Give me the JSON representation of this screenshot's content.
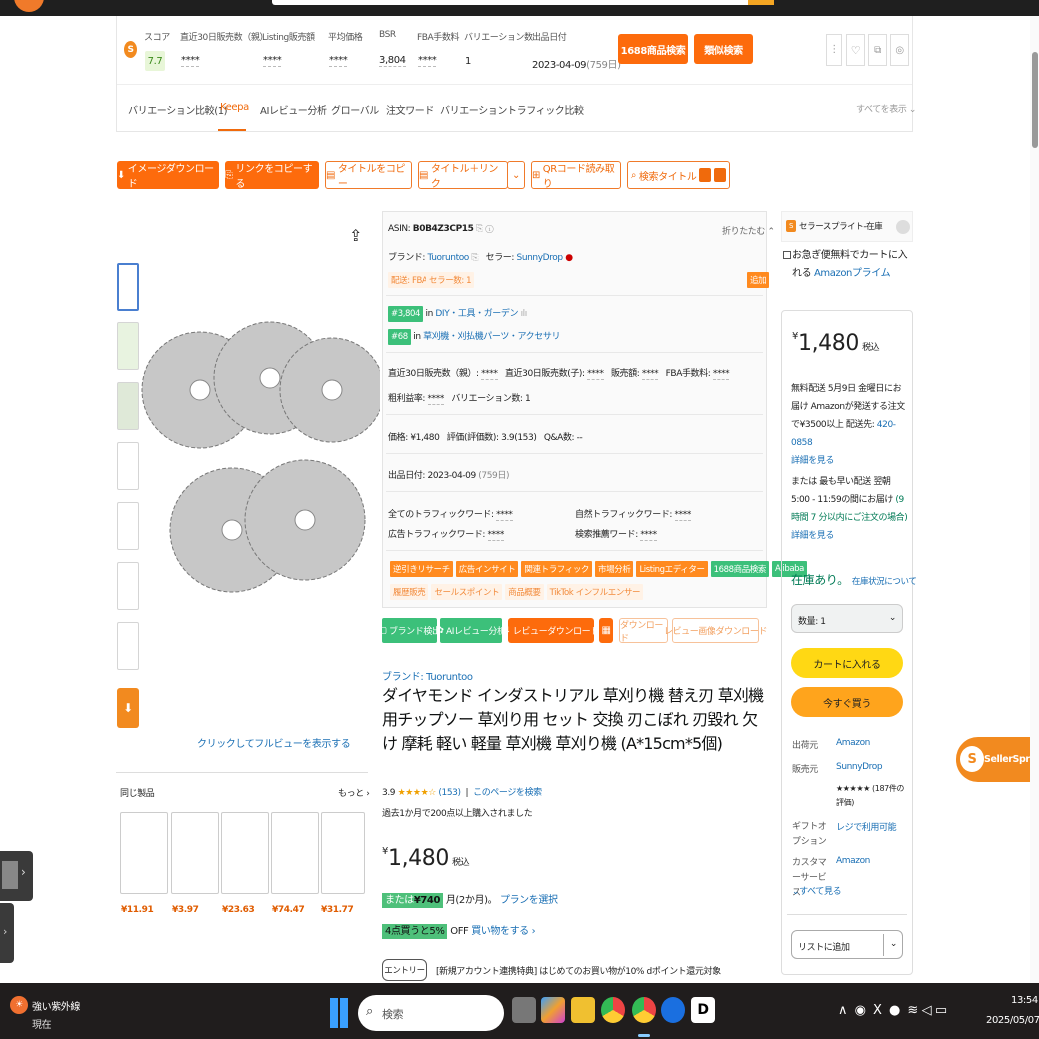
{
  "seller_bar": {
    "score_label": "スコア",
    "score": "7.7",
    "stats": [
      {
        "label": "直近30日販売数（親）",
        "value": "****"
      },
      {
        "label": "Listing販売額",
        "value": "****"
      },
      {
        "label": "平均価格",
        "value": "****"
      },
      {
        "label": "BSR",
        "value": "3,804"
      },
      {
        "label": "FBA手数料",
        "value": "****"
      },
      {
        "label": "バリエーション数",
        "value": "1"
      },
      {
        "label": "出品日付",
        "value": "2023-04-09"
      }
    ],
    "listing_days": "(759日)",
    "btn_1688": "1688商品検索",
    "btn_similar": "類似検索",
    "tabs": [
      "バリエーション比較(1)",
      "Keepa",
      "AIレビュー分析",
      "グローバル",
      "注文ワード",
      "バリエーショントラフィック比較"
    ],
    "show_all": "すべてを表示"
  },
  "toolbar": {
    "download_images": "イメージダウンロード",
    "copy_link": "リンクをコピーする",
    "copy_title": "タイトルをコピー",
    "title_link": "タイトル＋リンク",
    "qr": "QRコード読み取り",
    "search_title": "検索タイトル"
  },
  "gallery": {
    "full_view": "クリックしてフルビューを表示する",
    "similar": "同じ製品",
    "more": "もっと"
  },
  "similar_prices": [
    "¥11.91",
    "¥3.97",
    "¥23.63",
    "¥74.47",
    "¥31.77"
  ],
  "info": {
    "asin_label": "ASIN:",
    "asin": "B0B4Z3CP15",
    "collapse": "折りたたむ",
    "brand_label": "ブランド:",
    "brand": "Tuoruntoo",
    "seller_label": "セラー:",
    "seller": "SunnyDrop",
    "delivery": "配送: FBA",
    "seller_count": "セラー数: 1",
    "add": "追加",
    "rank1": "#3,804",
    "rank1_in": "in",
    "rank1_cat": "DIY・工具・ガーデン",
    "rank2": "#68",
    "rank2_cat": "草刈機・刈払機パーツ・アクセサリ",
    "row1": [
      {
        "label": "直近30日販売数（親）:",
        "value": "****"
      },
      {
        "label": "直近30日販売数(子):",
        "value": "****"
      },
      {
        "label": "販売額:",
        "value": "****"
      },
      {
        "label": "FBA手数料:",
        "value": "****"
      }
    ],
    "margin_label": "粗利益率:",
    "margin": "****",
    "variation_label": "バリエーション数:",
    "variation": "1",
    "price_label": "価格:",
    "price": "¥1,480",
    "rating_label": "評価(評価数):",
    "rating": "3.9(153)",
    "qa_label": "Q&A数:",
    "qa": "--",
    "date_label": "出品日付:",
    "date": "2023-04-09",
    "date_days": "(759日)",
    "traffic": [
      {
        "label": "全てのトラフィックワード:",
        "value": "****"
      },
      {
        "label": "自然トラフィックワード:",
        "value": "****"
      },
      {
        "label": "広告トラフィックワード:",
        "value": "****"
      },
      {
        "label": "検索推薦ワード:",
        "value": "****"
      }
    ],
    "tags_row1": [
      "逆引きリサーチ",
      "広告インサイト",
      "関連トラフィック",
      "市場分析",
      "Listingエディター",
      "1688商品検索",
      "Alibaba"
    ],
    "tags_row2": [
      "履歴販売",
      "セールスポイント",
      "商品概要",
      "TikTok インフルエンサー"
    ]
  },
  "action_row": {
    "brand": "ブランド検出",
    "ai": "AIレビュー分析",
    "review_dl": "レビューダウンロード",
    "download": "ダウンロード",
    "review_img": "レビュー画像ダウンロード"
  },
  "product": {
    "brand_link": "ブランド: Tuoruntoo",
    "title": "ダイヤモンド インダストリアル 草刈り機 替え刃 草刈機用チップソー 草刈り用 セット 交換 刃こぼれ 刃毀れ 欠け 摩耗 軽い 軽量 草刈機 草刈り機 (A*15cm*5個)",
    "rating": "3.9",
    "stars": "★★★★☆",
    "reviews": "(153)",
    "search_page": "このページを検索",
    "bought": "過去1か月で200点以上購入されました",
    "price_currency": "¥",
    "price": "1,480",
    "tax": "税込",
    "installment_pre": "または",
    "installment_price": "¥740",
    "installment_post": "月(2か月)。",
    "plan": "プランを選択",
    "bulk_tag": "4点買うと5%",
    "bulk_off": "OFF",
    "bulk_link": "買い物をする ›",
    "entry_btn": "エントリー",
    "entry_text": "[新規アカウント連携特典] はじめてのお買い物が10% dポイント還元対象"
  },
  "buybox": {
    "sprite_label": "セラースプライト-在庫",
    "prime_text": "お急ぎ便無料でカートに入れる",
    "prime_link": "Amazonプライム",
    "price_currency": "¥",
    "price": "1,480",
    "tax": "税込",
    "delivery": "無料配送 5月9日 金曜日にお届け Amazonが発送する注文で¥3500以上 配送先:",
    "zip": "420-0858",
    "details1": "詳細を見る",
    "fast": "または 最も早い配送 翌朝 5:00 - 11:59の間にお届け",
    "fast_link": "(9時間 7 分以内にご注文の場合)",
    "details2": "詳細を見る",
    "stock": "在庫あり。",
    "stock_link": "在庫状況について",
    "qty": "数量: 1",
    "cart": "カートに入れる",
    "buy_now": "今すぐ買う",
    "ship_from_label": "出荷元",
    "ship_from": "Amazon",
    "seller_label": "販売元",
    "seller": "SunnyDrop",
    "seller_stars": "★★★★★",
    "seller_reviews": "(187件の評価)",
    "gift_label": "ギフトオプション",
    "gift": "レジで利用可能",
    "cs_label": "カスタマーサービス",
    "cs": "Amazon",
    "show_all": "すべて見る",
    "list_add": "リストに追加"
  },
  "floating": {
    "sellersprite": "SellerSprite"
  },
  "taskbar": {
    "weather_title": "強い紫外線",
    "weather_sub": "現在",
    "search": "検索",
    "time": "13:54",
    "date": "2025/05/07"
  }
}
